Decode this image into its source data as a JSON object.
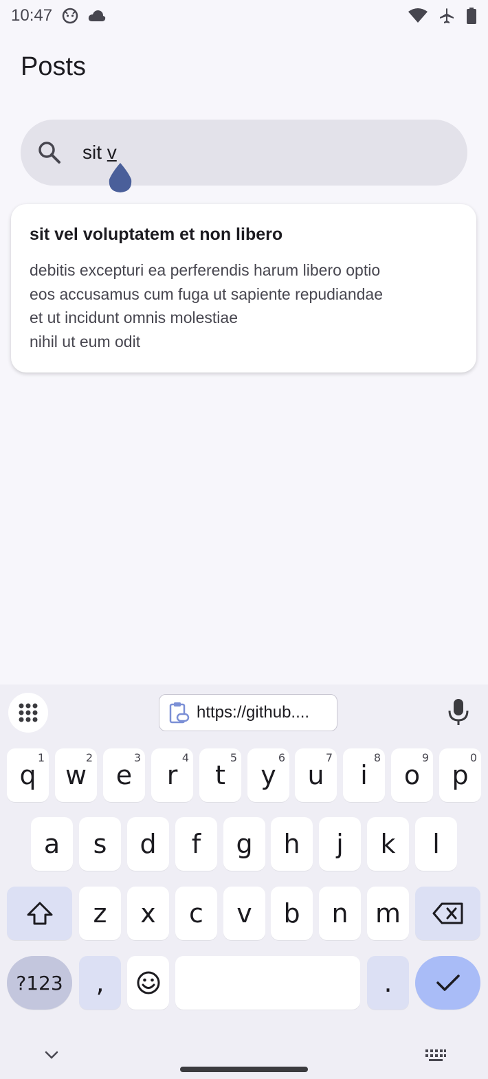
{
  "status": {
    "time": "10:47",
    "icons": [
      "android-face-icon",
      "cloud-icon",
      "wifi-icon",
      "airplane-icon",
      "battery-icon"
    ]
  },
  "header": {
    "title": "Posts"
  },
  "search": {
    "typed_prefix": "sit ",
    "composing": "v"
  },
  "posts": [
    {
      "title": "sit vel voluptatem et non libero",
      "body_lines": [
        "debitis excepturi ea perferendis harum libero optio",
        "eos accusamus cum fuga ut sapiente repudiandae",
        "et ut incidunt omnis molestiae",
        "nihil ut eum odit"
      ]
    }
  ],
  "keyboard": {
    "clipboard_text": "https://github....",
    "row1": [
      {
        "k": "q",
        "h": "1"
      },
      {
        "k": "w",
        "h": "2"
      },
      {
        "k": "e",
        "h": "3"
      },
      {
        "k": "r",
        "h": "4"
      },
      {
        "k": "t",
        "h": "5"
      },
      {
        "k": "y",
        "h": "6"
      },
      {
        "k": "u",
        "h": "7"
      },
      {
        "k": "i",
        "h": "8"
      },
      {
        "k": "o",
        "h": "9"
      },
      {
        "k": "p",
        "h": "0"
      }
    ],
    "row2": [
      "a",
      "s",
      "d",
      "f",
      "g",
      "h",
      "j",
      "k",
      "l"
    ],
    "row3": [
      "z",
      "x",
      "c",
      "v",
      "b",
      "n",
      "m"
    ],
    "symbols_label": "?123",
    "comma": ",",
    "period": "."
  },
  "colors": {
    "accent": "#4a5f9a",
    "enter_key": "#a9bcf7",
    "function_key": "#dce0f4"
  }
}
